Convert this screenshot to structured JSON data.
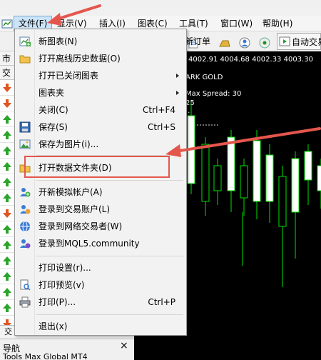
{
  "menubar": {
    "items": [
      {
        "label": "文件(F)",
        "active": true
      },
      {
        "label": "显示(V)"
      },
      {
        "label": "插入(I)"
      },
      {
        "label": "图表(C)"
      },
      {
        "label": "工具(T)"
      },
      {
        "label": "窗口(W)"
      },
      {
        "label": "帮助(H)"
      }
    ]
  },
  "toolbar": {
    "new_order_label": "新订单",
    "auto_trading_label": "自动交易"
  },
  "left_panel": {
    "tab_market": "市场",
    "tab_symbol": "交易",
    "tab_bottom": "交"
  },
  "navigator": {
    "title": "导航",
    "close": "×",
    "row_text": "Tools Max Global MT4"
  },
  "chart": {
    "price_row": "4002.91 4004.68 4002.33 4003.30",
    "symbol": "ARK GOLD",
    "spread_label": "Max Spread: 30",
    "fragment_1": "25",
    "fragment_2": "..."
  },
  "file_menu": {
    "items": [
      {
        "label": "新图表(N)",
        "icon": "new-chart-icon",
        "shortcut": "",
        "submenu": false
      },
      {
        "label": "打开离线历史数据(O)",
        "icon": "open-folder-icon",
        "shortcut": "",
        "submenu": false
      },
      {
        "label": "打开已关闭图表",
        "icon": "",
        "shortcut": "",
        "submenu": true
      },
      {
        "label": "图表夹",
        "icon": "",
        "shortcut": "",
        "submenu": true
      },
      {
        "label": "关闭(C)",
        "icon": "",
        "shortcut": "Ctrl+F4",
        "submenu": false
      },
      {
        "label": "保存(S)",
        "icon": "save-floppy-icon",
        "shortcut": "Ctrl+S",
        "submenu": false
      },
      {
        "label": "保存为图片(i)...",
        "icon": "save-picture-icon",
        "shortcut": "",
        "submenu": false
      },
      {
        "label": "打开数据文件夹(D)",
        "icon": "data-folder-icon",
        "shortcut": "",
        "submenu": false
      },
      {
        "label": "开新模拟帐户(A)",
        "icon": "demo-account-icon",
        "shortcut": "",
        "submenu": false
      },
      {
        "label": "登录到交易账户(L)",
        "icon": "login-account-icon",
        "shortcut": "",
        "submenu": false
      },
      {
        "label": "登录到网络交易者(W)",
        "icon": "web-trader-icon",
        "shortcut": "",
        "submenu": false
      },
      {
        "label": "登录到MQL5.community",
        "icon": "mql5-community-icon",
        "shortcut": "",
        "submenu": false
      },
      {
        "label": "打印设置(r)...",
        "icon": "",
        "shortcut": "",
        "submenu": false
      },
      {
        "label": "打印预览(v)",
        "icon": "print-preview-icon",
        "shortcut": "",
        "submenu": false
      },
      {
        "label": "打印(P)...",
        "icon": "printer-icon",
        "shortcut": "Ctrl+P",
        "submenu": false
      },
      {
        "label": "退出(x)",
        "icon": "",
        "shortcut": "",
        "submenu": false
      }
    ]
  },
  "colors": {
    "bull_candle": "#00e000",
    "highlight": "#e4564c",
    "menu_active": "#cce4f7"
  }
}
